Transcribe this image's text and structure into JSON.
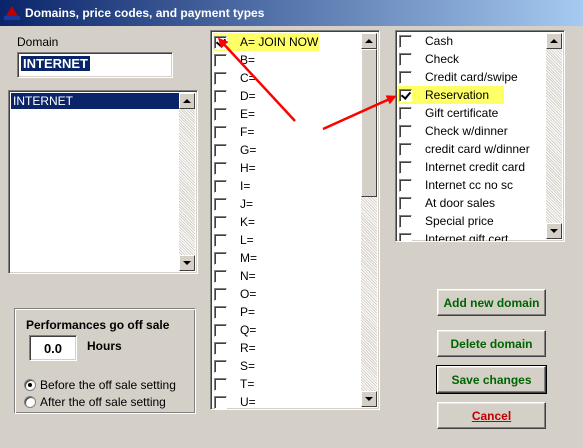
{
  "window": {
    "title": "Domains, price codes, and payment types"
  },
  "domain": {
    "label": "Domain",
    "value": "INTERNET",
    "list_items": [
      "INTERNET"
    ]
  },
  "price_codes": [
    {
      "label": "A= JOIN NOW",
      "checked": true,
      "highlight": true
    },
    {
      "label": "B=",
      "checked": false
    },
    {
      "label": "C=",
      "checked": false
    },
    {
      "label": "D=",
      "checked": false
    },
    {
      "label": "E=",
      "checked": false
    },
    {
      "label": "F=",
      "checked": false
    },
    {
      "label": "G=",
      "checked": false
    },
    {
      "label": "H=",
      "checked": false
    },
    {
      "label": "I=",
      "checked": false
    },
    {
      "label": "J=",
      "checked": false
    },
    {
      "label": "K=",
      "checked": false
    },
    {
      "label": "L=",
      "checked": false
    },
    {
      "label": "M=",
      "checked": false
    },
    {
      "label": "N=",
      "checked": false
    },
    {
      "label": "O=",
      "checked": false
    },
    {
      "label": "P=",
      "checked": false
    },
    {
      "label": "Q=",
      "checked": false
    },
    {
      "label": "R=",
      "checked": false
    },
    {
      "label": "S=",
      "checked": false
    },
    {
      "label": "T=",
      "checked": false
    },
    {
      "label": "U=",
      "checked": false
    }
  ],
  "payment_types": [
    {
      "label": "Cash",
      "checked": false
    },
    {
      "label": "Check",
      "checked": false
    },
    {
      "label": "Credit card/swipe",
      "checked": false
    },
    {
      "label": "Reservation",
      "checked": true,
      "highlight": true
    },
    {
      "label": "Gift certificate",
      "checked": false
    },
    {
      "label": "Check w/dinner",
      "checked": false
    },
    {
      "label": "credit card w/dinner",
      "checked": false
    },
    {
      "label": "Internet credit card",
      "checked": false
    },
    {
      "label": "Internet cc no sc",
      "checked": false
    },
    {
      "label": "At door sales",
      "checked": false
    },
    {
      "label": "Special price",
      "checked": false
    },
    {
      "label": "Internet gift cert",
      "checked": false
    }
  ],
  "off_sale": {
    "title": "Performances go off sale",
    "hours_value": "0.0",
    "hours_label": "Hours",
    "options": [
      "Before the off sale setting",
      "After the off sale setting"
    ],
    "selected_index": 0
  },
  "buttons": {
    "add_domain": "Add new domain",
    "delete_domain": "Delete domain",
    "save_changes": "Save changes",
    "cancel": "Cancel"
  },
  "colors": {
    "highlight": "#ffff66",
    "arrow": "#ff0000",
    "button_text": "#006400",
    "cancel_text": "#c00000",
    "selection": "#0a246a"
  }
}
